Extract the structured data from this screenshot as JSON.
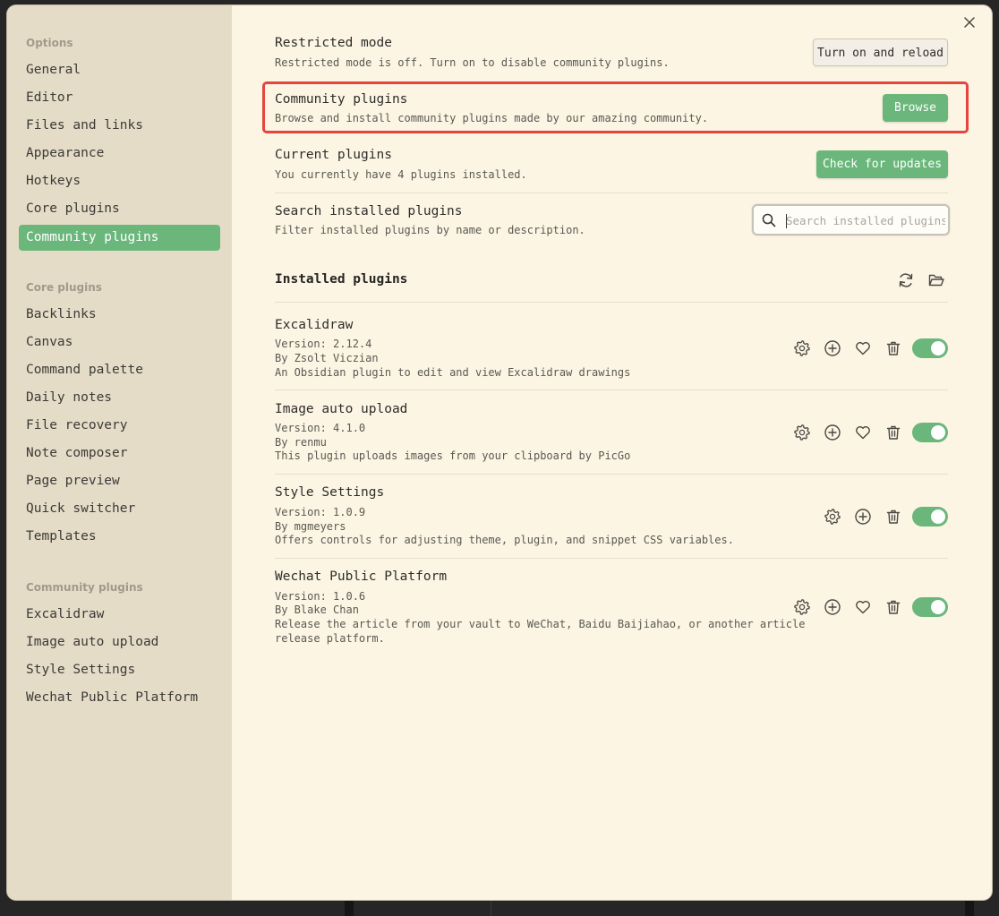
{
  "sidebar": {
    "options_heading": "Options",
    "options": [
      {
        "label": "General"
      },
      {
        "label": "Editor"
      },
      {
        "label": "Files and links"
      },
      {
        "label": "Appearance"
      },
      {
        "label": "Hotkeys"
      },
      {
        "label": "Core plugins"
      },
      {
        "label": "Community plugins",
        "active": true
      }
    ],
    "core_heading": "Core plugins",
    "core": [
      {
        "label": "Backlinks"
      },
      {
        "label": "Canvas"
      },
      {
        "label": "Command palette"
      },
      {
        "label": "Daily notes"
      },
      {
        "label": "File recovery"
      },
      {
        "label": "Note composer"
      },
      {
        "label": "Page preview"
      },
      {
        "label": "Quick switcher"
      },
      {
        "label": "Templates"
      }
    ],
    "community_heading": "Community plugins",
    "community": [
      {
        "label": "Excalidraw"
      },
      {
        "label": "Image auto upload"
      },
      {
        "label": "Style Settings"
      },
      {
        "label": "Wechat Public Platform"
      }
    ]
  },
  "settings": {
    "restricted": {
      "name": "Restricted mode",
      "desc": "Restricted mode is off. Turn on to disable community plugins.",
      "button": "Turn on and reload"
    },
    "community": {
      "name": "Community plugins",
      "desc": "Browse and install community plugins made by our amazing community.",
      "button": "Browse"
    },
    "current": {
      "name": "Current plugins",
      "desc": "You currently have 4 plugins installed.",
      "button": "Check for updates"
    },
    "search": {
      "name": "Search installed plugins",
      "desc": "Filter installed plugins by name or description.",
      "placeholder": "Search installed plugins...",
      "value": ""
    }
  },
  "installed": {
    "title": "Installed plugins",
    "plugins": [
      {
        "name": "Excalidraw",
        "version": "Version: 2.12.4",
        "author": "By Zsolt Viczian",
        "desc": [
          "An Obsidian plugin to edit and view Excalidraw drawings"
        ],
        "enabled": true
      },
      {
        "name": "Image auto upload",
        "version": "Version: 4.1.0",
        "author": "By renmu",
        "desc": [
          "This plugin uploads images from your clipboard by PicGo"
        ],
        "enabled": true
      },
      {
        "name": "Style Settings",
        "version": "Version: 1.0.9",
        "author": "By mgmeyers",
        "desc": [
          "Offers controls for adjusting theme, plugin, and snippet CSS variables."
        ],
        "enabled": true
      },
      {
        "name": "Wechat Public Platform",
        "version": "Version: 1.0.6",
        "author": "By Blake Chan",
        "desc": [
          "Release the article from your vault to WeChat, Baidu Baijiahao, or another article",
          "release platform."
        ],
        "enabled": true
      }
    ]
  },
  "colors": {
    "accent": "#6bb77b",
    "highlight_border": "#e5453d",
    "background": "#fcf5e4",
    "sidebar": "#e5dcc8"
  }
}
